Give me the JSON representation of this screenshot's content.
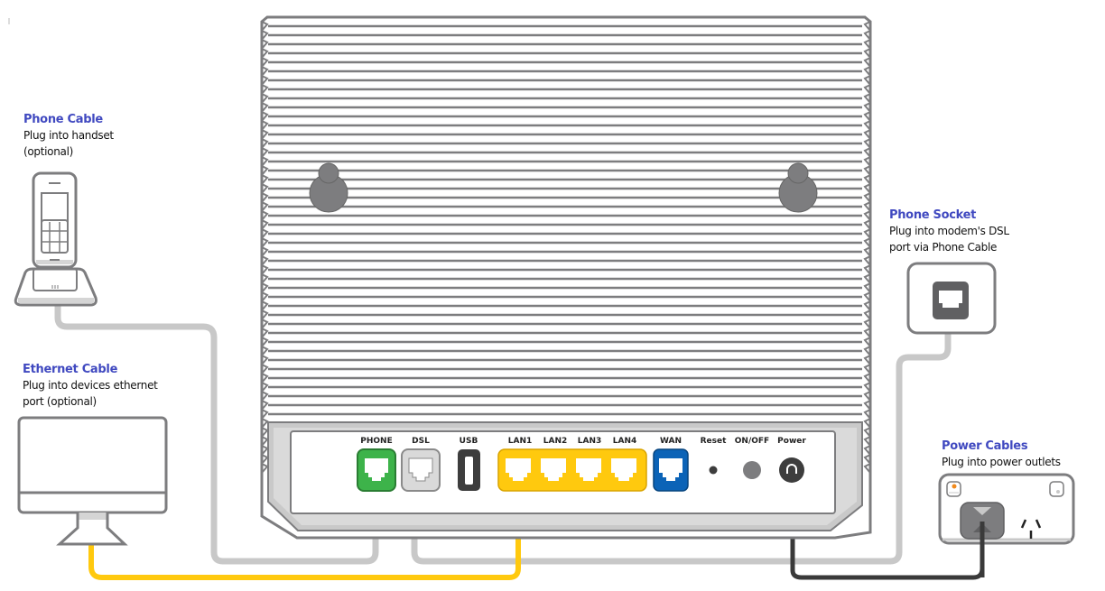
{
  "colors": {
    "heading": "#4049c0",
    "cable_grey": "#c8c8c8",
    "cable_yellow": "#ffc90e",
    "cable_black": "#3a3a3a",
    "housing_grey": "#7d7d7f",
    "port_green": "#3db34a",
    "port_dsl": "#d9d9d9",
    "port_usb": "#3d3d3d",
    "port_lan": "#ffc90e",
    "port_wan": "#0b63b7",
    "outlet_led": "#f18a1c"
  },
  "captions": {
    "phone_cable": {
      "title": "Phone Cable",
      "lines": [
        "Plug into handset",
        "(optional)"
      ]
    },
    "ethernet_cable": {
      "title": "Ethernet Cable",
      "lines": [
        "Plug into devices ethernet",
        "port (optional)"
      ]
    },
    "phone_socket": {
      "title": "Phone Socket",
      "lines": [
        "Plug into modem's DSL",
        "port via Phone Cable"
      ]
    },
    "power_cables": {
      "title": "Power Cables",
      "lines": [
        "Plug into power outlets"
      ]
    }
  },
  "modem": {
    "ports": {
      "phone": "PHONE",
      "dsl": "DSL",
      "usb": "USB",
      "lan1": "LAN1",
      "lan2": "LAN2",
      "lan3": "LAN3",
      "lan4": "LAN4",
      "wan": "WAN",
      "reset": "Reset",
      "onoff": "ON/OFF",
      "power": "Power"
    }
  },
  "devices": {
    "handset": "phone-handset-icon",
    "computer": "desktop-monitor-icon",
    "wall_socket": "phone-wall-socket-icon",
    "power_outlet": "power-outlet-icon"
  }
}
